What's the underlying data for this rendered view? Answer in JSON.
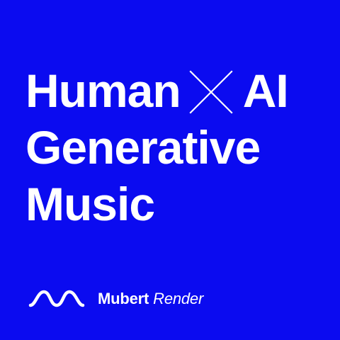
{
  "colors": {
    "background": "#0B0BF0",
    "foreground": "#FFFFFF"
  },
  "headline": {
    "word_human": "Human",
    "separator_icon": "cross-icon",
    "word_ai": "AI",
    "line_2": "Generative",
    "line_3": "Music"
  },
  "brand": {
    "logo_icon": "wave-logo-icon",
    "name": "Mubert",
    "product": "Render"
  }
}
